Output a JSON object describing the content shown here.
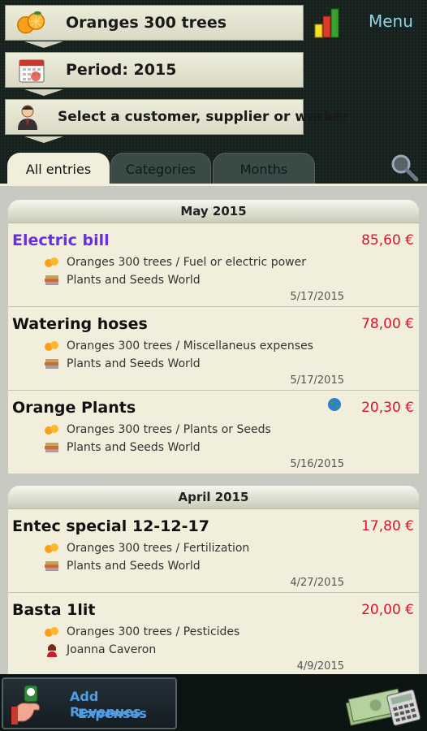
{
  "header": {
    "farm_selector": {
      "label": "Oranges   300 trees",
      "icon": "oranges-icon"
    },
    "period_selector": {
      "label": "Period: 2015",
      "icon": "calendar-icon"
    },
    "contact_selector": {
      "label": "Select a customer, supplier or worker",
      "icon": "person-icon"
    },
    "menu_label": "Menu",
    "chart_icon": "bar-chart-icon"
  },
  "tabs": [
    {
      "label": "All entries",
      "active": true
    },
    {
      "label": "Categories",
      "active": false
    },
    {
      "label": "Months",
      "active": false
    }
  ],
  "groups": [
    {
      "month": "May 2015",
      "entries": [
        {
          "title": "Electric bill",
          "amount": "85,60 €",
          "line1": "Oranges   300 trees  / Fuel or electric power",
          "line2": "Plants and Seeds World",
          "date": "5/17/2015",
          "highlight": true
        },
        {
          "title": "Watering hoses",
          "amount": "78,00 €",
          "line1": "Oranges   300 trees  / Miscellaneus expenses",
          "line2": "Plants and Seeds World",
          "date": "5/17/2015"
        },
        {
          "title": "Orange Plants",
          "amount": "20,30 €",
          "line1": "Oranges   300 trees  / Plants or Seeds",
          "line2": "Plants and Seeds World",
          "date": "5/16/2015",
          "globe": true
        }
      ]
    },
    {
      "month": "April 2015",
      "entries": [
        {
          "title": "Entec special 12-12-17",
          "amount": "17,80 €",
          "line1": "Oranges   300 trees  / Fertilization",
          "line2": "Plants and Seeds World",
          "date": "4/27/2015"
        },
        {
          "title": "Basta 1lit",
          "amount": "20,00 €",
          "line1": "Oranges   300 trees  / Pesticides",
          "line2": "Joanna Caveron",
          "date": "4/9/2015",
          "person": true
        }
      ]
    }
  ],
  "bottom": {
    "add_line1": "Add Revenues",
    "add_line2": "Expenses"
  },
  "colors": {
    "amount": "#e0102e",
    "highlight_title": "#6a2ee6",
    "menu": "#8fd6e8",
    "add_text": "#4f9ee6"
  }
}
